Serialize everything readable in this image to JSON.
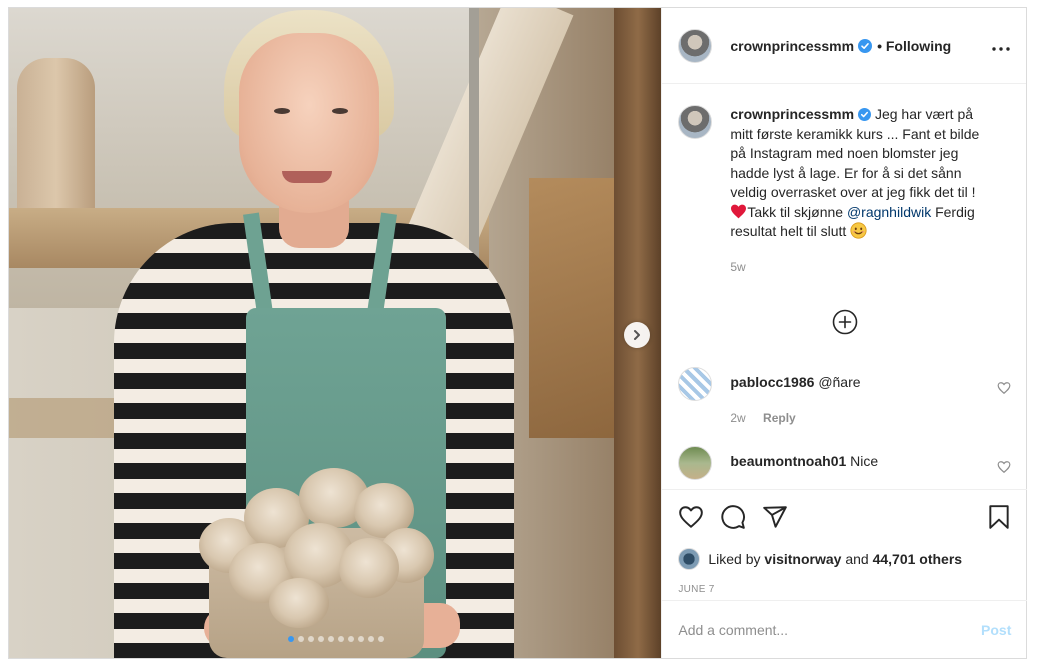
{
  "header": {
    "username": "crownprincessmm",
    "follow_status": "• Following",
    "more_icon": "more-horizontal-icon"
  },
  "caption": {
    "username": "crownprincessmm",
    "text_before_heart": "Jeg har vært på mitt første keramikk kurs ... Fant et bilde på Instagram med noen blomster jeg hadde lyst å lage. Er for å si det sånn veldig overrasket over at jeg fikk det til ! ",
    "heart_emoji": "❤️",
    "text_after_heart": "Takk til skjønne ",
    "mention": "@ragnhildwik",
    "text_end": " Ferdig resultat helt til slutt ",
    "smile_emoji": "😊",
    "age": "5w"
  },
  "comments": [
    {
      "username": "pablocc1986",
      "text": "@ñare",
      "age": "2w",
      "reply_label": "Reply"
    },
    {
      "username": "beaumontnoah01",
      "text": "Nice"
    }
  ],
  "likes": {
    "prefix": "Liked by ",
    "user": "visitnorway",
    "middle": " and ",
    "count": "44,701 others"
  },
  "post_date": "JUNE 7",
  "add_comment": {
    "placeholder": "Add a comment...",
    "post_label": "Post"
  },
  "carousel": {
    "total": 10,
    "active_index": 0
  },
  "colors": {
    "accent": "#3897f0",
    "verified": "#3897f0",
    "heart": "#ed4956",
    "post_disabled": "#b2dffc"
  }
}
